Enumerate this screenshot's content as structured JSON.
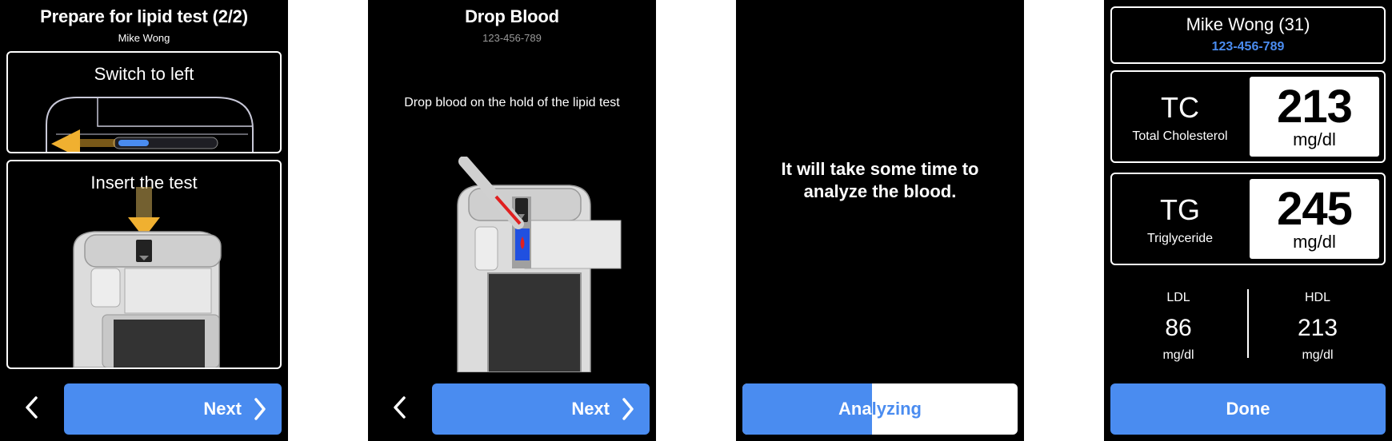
{
  "screen1": {
    "title": "Prepare for lipid test (2/2)",
    "subtitle": "Mike Wong",
    "step1_label": "Switch to left",
    "step2_label": "Insert the test",
    "next_label": "Next",
    "back_icon": "chevron-left-icon",
    "next_icon": "chevron-right-icon"
  },
  "screen2": {
    "title": "Drop Blood",
    "subtitle": "123-456-789",
    "instruction": "Drop blood on the hold of the lipid test",
    "next_label": "Next"
  },
  "screen3": {
    "message": "It will take some time to analyze the blood.",
    "progress_label": "Analyzing",
    "progress_fraction": 0.47
  },
  "screen4": {
    "patient_name": "Mike Wong (31)",
    "patient_id": "123-456-789",
    "tc": {
      "abbr": "TC",
      "name": "Total Cholesterol",
      "value": "213",
      "unit": "mg/dl"
    },
    "tg": {
      "abbr": "TG",
      "name": "Triglyceride",
      "value": "245",
      "unit": "mg/dl"
    },
    "ldl": {
      "name": "LDL",
      "value": "86",
      "unit": "mg/dl"
    },
    "hdl": {
      "name": "HDL",
      "value": "213",
      "unit": "mg/dl"
    },
    "done_label": "Done"
  },
  "colors": {
    "accent": "#4a8cf0",
    "background": "#000000",
    "text": "#ffffff",
    "blood": "#e02020",
    "arrow": "#f0b030"
  }
}
